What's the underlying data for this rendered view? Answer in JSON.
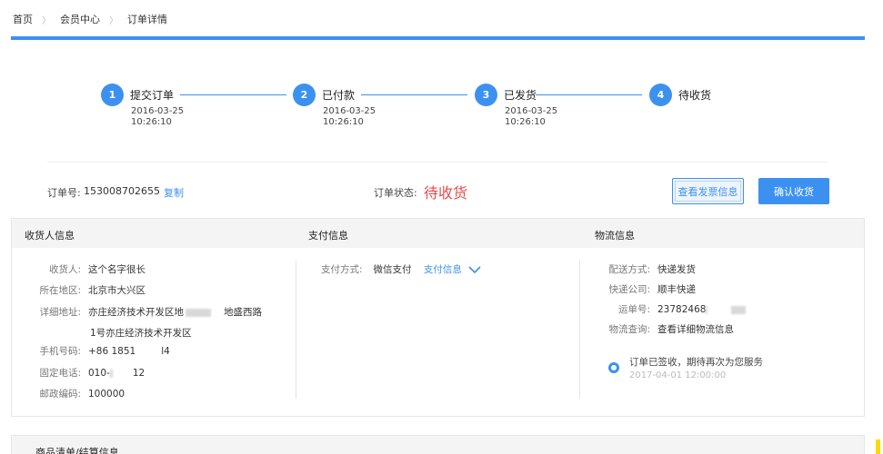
{
  "breadcrumb": {
    "items": [
      "首页",
      "会员中心",
      "订单详情"
    ]
  },
  "steps": [
    {
      "num": "1",
      "label": "提交订单",
      "date": "2016-03-25",
      "time": "10:26:10"
    },
    {
      "num": "2",
      "label": "已付款",
      "date": "2016-03-25",
      "time": "10:26:10"
    },
    {
      "num": "3",
      "label": "已发货",
      "date": "2016-03-25",
      "time": "10:26:10"
    },
    {
      "num": "4",
      "label": "待收货"
    }
  ],
  "order": {
    "no_label": "订单号:",
    "no": "153008702655",
    "copy": "复制",
    "status_label": "订单状态:",
    "status": "待收货",
    "invoice_button": "查看发票信息",
    "confirm_button": "确认收货"
  },
  "receiver": {
    "title": "收货人信息",
    "name_label": "收货人:",
    "name": "这个名字很长",
    "region_label": "所在地区:",
    "region": "北京市大兴区",
    "address_label": "详细地址:",
    "address_1": "亦庄经济技术开发区地",
    "address_1b": "地盛西路",
    "address_2": "1号亦庄经济技术开发区",
    "mobile_label": "手机号码:",
    "mobile_a": "+86 1851",
    "mobile_b": "l4",
    "phone_label": "固定电话:",
    "phone_a": "010-",
    "phone_b": "12",
    "zip_label": "邮政编码:",
    "zip": "100000"
  },
  "payment": {
    "title": "支付信息",
    "method_label": "支付方式:",
    "method": "微信支付",
    "info_link": "支付信息"
  },
  "logistics": {
    "title": "物流信息",
    "ship_label": "配送方式:",
    "ship": "快递发货",
    "company_label": "快递公司:",
    "company": "顺丰快递",
    "tracking_label": "运单号:",
    "tracking": "23782468",
    "query_label": "物流查询:",
    "query_link": "查看详细物流信息",
    "note": "订单已签收，期待再次为您服务",
    "note_time": "2017-04-01 12:00:00"
  },
  "goods": {
    "title": "商品清单/结算信息"
  },
  "colors": {
    "accent": "#3c91f0",
    "status": "#e84b4b"
  }
}
